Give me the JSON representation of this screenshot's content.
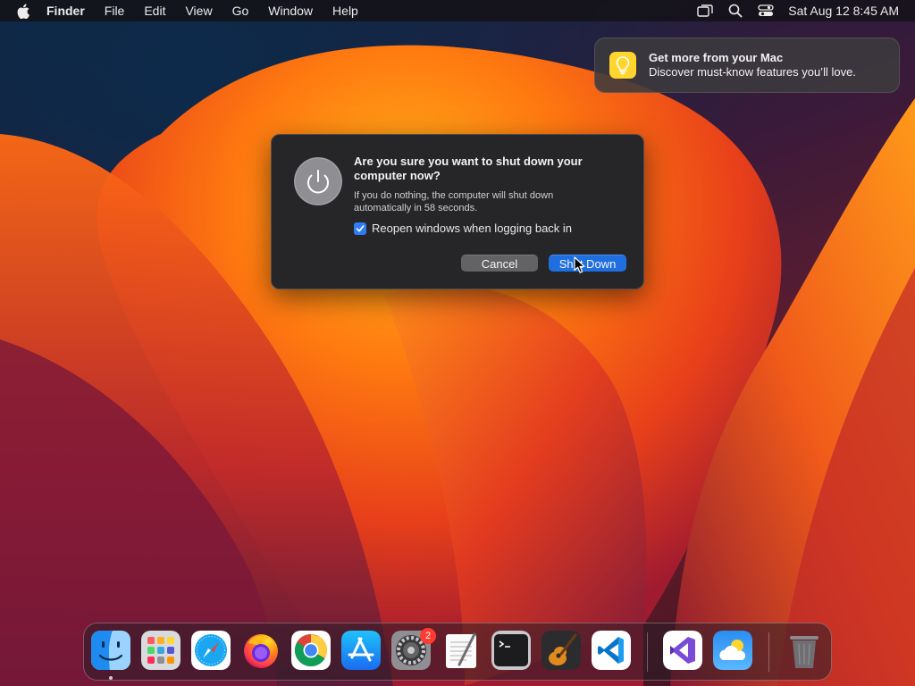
{
  "menubar": {
    "app_name": "Finder",
    "items": [
      "File",
      "Edit",
      "View",
      "Go",
      "Window",
      "Help"
    ],
    "clock": "Sat Aug 12  8:45 AM",
    "status_icons": [
      "screen-mirroring-icon",
      "spotlight-search-icon",
      "control-center-icon"
    ]
  },
  "notification": {
    "title": "Get more from your Mac",
    "body": "Discover must-know features you’ll love.",
    "icon": "lightbulb-icon"
  },
  "dialog": {
    "title": "Are you sure you want to shut down your computer now?",
    "message": "If you do nothing, the computer will shut down automatically in 58 seconds.",
    "checkbox_label": "Reopen windows when logging back in",
    "checkbox_checked": true,
    "cancel_label": "Cancel",
    "confirm_label": "Shut Down",
    "icon": "power-icon"
  },
  "dock": {
    "apps": [
      {
        "name": "Finder",
        "icon": "finder-icon",
        "running": true
      },
      {
        "name": "Launchpad",
        "icon": "launchpad-icon"
      },
      {
        "name": "Safari",
        "icon": "safari-icon"
      },
      {
        "name": "Firefox",
        "icon": "firefox-icon"
      },
      {
        "name": "Google Chrome",
        "icon": "chrome-icon"
      },
      {
        "name": "App Store",
        "icon": "app-store-icon"
      },
      {
        "name": "System Settings",
        "icon": "system-settings-icon",
        "badge": "2"
      },
      {
        "name": "TextEdit",
        "icon": "textedit-icon"
      },
      {
        "name": "Terminal",
        "icon": "terminal-icon"
      },
      {
        "name": "GarageBand",
        "icon": "garageband-icon"
      },
      {
        "name": "Visual Studio Code",
        "icon": "vscode-icon"
      },
      {
        "name": "Visual Studio",
        "icon": "visual-studio-icon"
      },
      {
        "name": "Weather",
        "icon": "weather-icon"
      },
      {
        "name": "Trash",
        "icon": "trash-icon"
      }
    ]
  },
  "colors": {
    "accent": "#1f6fe0",
    "dialog_bg": "#262628",
    "badge": "#ff3b30",
    "notification_icon": "#ffd52e"
  }
}
